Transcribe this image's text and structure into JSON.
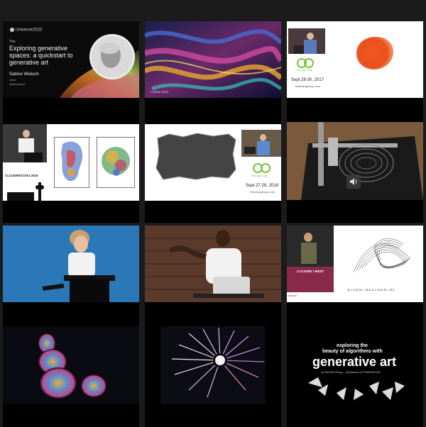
{
  "videos": [
    {
      "id": "universe-talk",
      "brand": "Universe2020",
      "title_line1": "Exploring generative",
      "title_line2": "spaces: a quickstart to",
      "title_line3": "generative art",
      "speaker": "Sabine Wieluch",
      "role": "Artist",
      "handle": "@bleeptrack",
      "intro": "The"
    },
    {
      "id": "ribbon-art",
      "caption": "LOREM JIM'S"
    },
    {
      "id": "strangeloop-2017",
      "logo_text": "strange loop",
      "dates": "Sept 28-30, 2017",
      "url": "thestrangeloop.com"
    },
    {
      "id": "clojure-conj-2016",
      "event": "CLOJURE/CONJ 2016"
    },
    {
      "id": "strangeloop-2018",
      "logo_text": "strange loop",
      "dates": "Sept 27-28, 2018",
      "url": "thestrangeloop.com"
    },
    {
      "id": "plotter-machine",
      "icon": "volume-icon"
    },
    {
      "id": "speaker-blue-stage"
    },
    {
      "id": "speaker-brick-wall"
    },
    {
      "id": "clojure-west",
      "event": "CLOJURE / WEST",
      "formula": "a = 1.4, b = -2.3, c = 2.4, d = -2.1",
      "sponsor": "factual"
    },
    {
      "id": "dot-blobs"
    },
    {
      "id": "radial-lines"
    },
    {
      "id": "fossasia-talk",
      "line1": "exploring the",
      "line2": "beauty of algorithms with",
      "title": "generative art",
      "byline": "by Shai Wei Chong — @shawnde at FOSSASIA 2016"
    }
  ]
}
